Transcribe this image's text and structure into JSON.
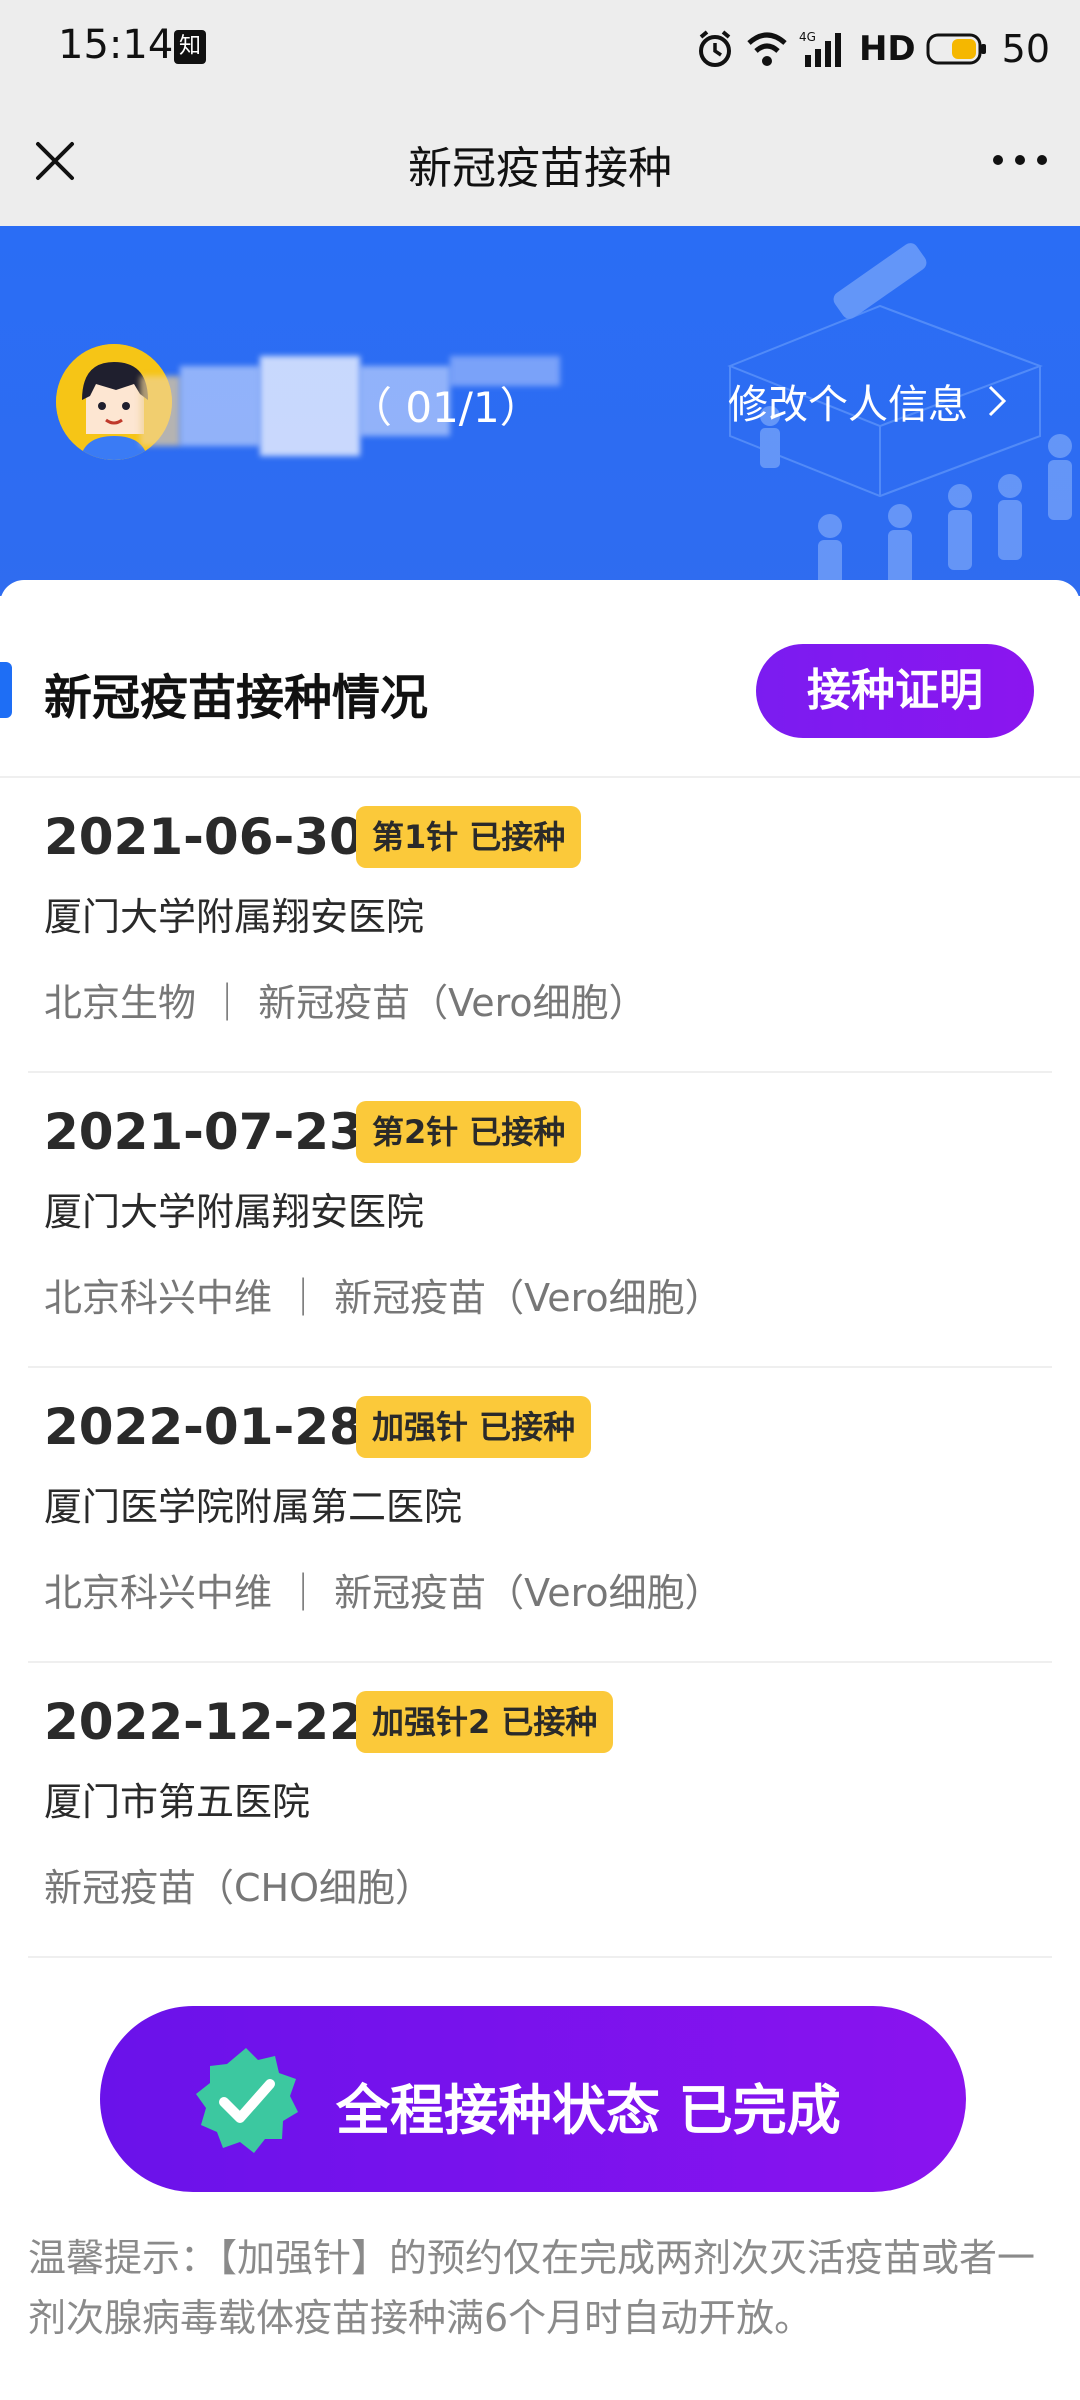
{
  "status_bar": {
    "time": "15:14",
    "app_badge": "知",
    "network": "4G",
    "hd_label": "HD",
    "battery": "50"
  },
  "nav": {
    "title": "新冠疫苗接种",
    "close_icon": "close-icon",
    "more_icon": "more-icon"
  },
  "banner": {
    "name_suffix": "（ 01/1）",
    "edit_label": "修改个人信息",
    "accent": "#2a6df5"
  },
  "section": {
    "title": "新冠疫苗接种情况",
    "cert_button": "接种证明"
  },
  "records": [
    {
      "date": "2021-06-30",
      "badge": "第1针 已接种",
      "hospital": "厦门大学附属翔安医院",
      "vaccine": "北京生物 ｜ 新冠疫苗（Vero细胞）"
    },
    {
      "date": "2021-07-23",
      "badge": "第2针 已接种",
      "hospital": "厦门大学附属翔安医院",
      "vaccine": "北京科兴中维 ｜ 新冠疫苗（Vero细胞）"
    },
    {
      "date": "2022-01-28",
      "badge": "加强针 已接种",
      "hospital": "厦门医学院附属第二医院",
      "vaccine": "北京科兴中维 ｜ 新冠疫苗（Vero细胞）"
    },
    {
      "date": "2022-12-22",
      "badge": "加强针2 已接种",
      "hospital": "厦门市第五医院",
      "vaccine": "新冠疫苗（CHO细胞）"
    }
  ],
  "complete": {
    "label": "全程接种状态 已完成",
    "badge_color": "#3cc8a0"
  },
  "tip": "温馨提示：【加强针】的预约仅在完成两剂次灭活疫苗或者一剂次腺病毒载体疫苗接种满6个月时自动开放。"
}
